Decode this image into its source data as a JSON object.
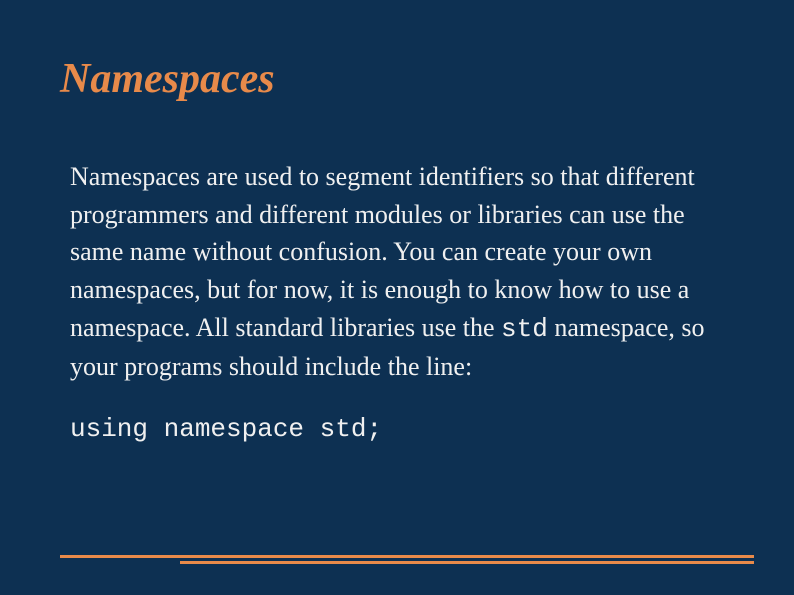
{
  "slide": {
    "title": "Namespaces",
    "body_before_code": "Namespaces are used to segment identifiers so that different programmers and different modules or libraries can use the same name without confusion. You can create your own namespaces, but for now, it is enough to know how to use a namespace. All standard libraries use the ",
    "body_code_inline": "std",
    "body_after_code": " namespace, so your programs should include the line:",
    "code_line": "using namespace std;"
  }
}
